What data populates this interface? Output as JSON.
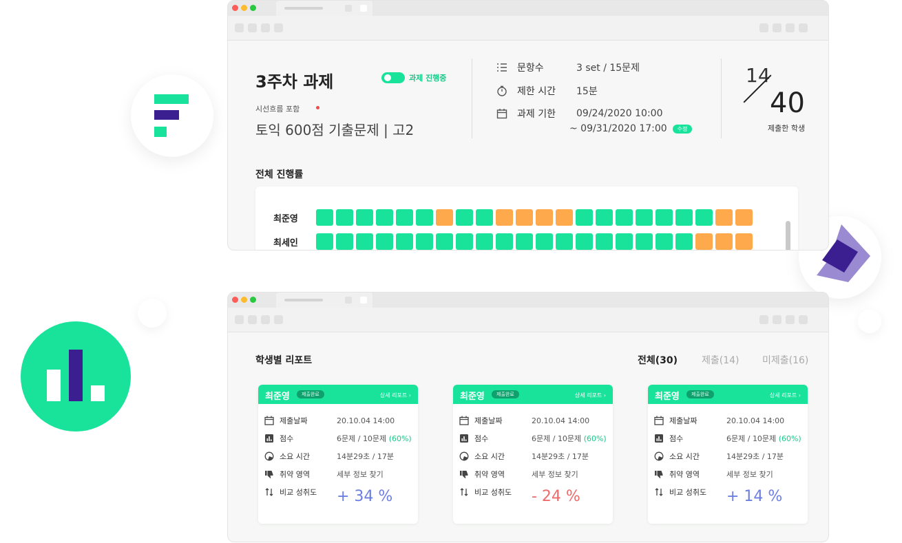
{
  "colors": {
    "accent": "#19e39a",
    "orange": "#ffa94d",
    "purple": "#3b1e8f",
    "purple_light": "#9a8ad1",
    "positive_blue": "#6c7ee1",
    "negative_red": "#f06a6a"
  },
  "assignment": {
    "title": "3주차 과제",
    "status": "과제 진행중",
    "category": "시선흐름 포함",
    "exam": "토익 600점 기출문제 |  고2",
    "info": [
      {
        "icon": "list-icon",
        "label": "문항수",
        "value": "3 set / 15문제"
      },
      {
        "icon": "timer-icon",
        "label": "제한 시간",
        "value": "15분"
      },
      {
        "icon": "calendar-icon",
        "label": "과제 기한",
        "value": "09/24/2020  10:00"
      }
    ],
    "deadline_end": "~  09/31/2020  17:00",
    "edit_label": "수정",
    "submitted": "14",
    "total": "40",
    "submitted_label": "제출한 학생"
  },
  "progress": {
    "title": "전체 진행률",
    "rows": [
      {
        "name": "최준영",
        "cells": [
          "g",
          "g",
          "g",
          "g",
          "g",
          "g",
          "o",
          "g",
          "g",
          "o",
          "o",
          "o",
          "o",
          "g",
          "g",
          "g",
          "g",
          "g",
          "g",
          "g",
          "o",
          "o"
        ]
      },
      {
        "name": "최세인",
        "cells": [
          "g",
          "g",
          "g",
          "g",
          "g",
          "g",
          "g",
          "g",
          "g",
          "g",
          "g",
          "g",
          "g",
          "g",
          "g",
          "g",
          "g",
          "g",
          "g",
          "o",
          "o",
          "o"
        ]
      }
    ]
  },
  "report": {
    "title": "학생별 리포트",
    "filters": [
      {
        "label": "전체(30)",
        "active": true
      },
      {
        "label": "제출(14)",
        "active": false
      },
      {
        "label": "미제출(16)",
        "active": false
      }
    ],
    "field_labels": {
      "date": "제출날짜",
      "score": "점수",
      "time": "소요 시간",
      "weak": "취약 영역",
      "compare": "비교 성취도"
    },
    "cards": [
      {
        "name": "최준영",
        "badge": "제출완료",
        "link": "상세 리포트 ›",
        "date": "20.10.04 14:00",
        "score": "6문제 / 10문제",
        "score_pct": "(60%)",
        "time": "14분29초 / 17분",
        "weak": "세부 정보 찾기",
        "compare": "+ 34 %",
        "compare_positive": true
      },
      {
        "name": "최준영",
        "badge": "제출완료",
        "link": "상세 리포트 ›",
        "date": "20.10.04 14:00",
        "score": "6문제 / 10문제",
        "score_pct": "(60%)",
        "time": "14분29초 / 17분",
        "weak": "세부 정보 찾기",
        "compare": "- 24 %",
        "compare_positive": false
      },
      {
        "name": "최준영",
        "badge": "제출완료",
        "link": "상세 리포트 ›",
        "date": "20.10.04 14:00",
        "score": "6문제 / 10문제",
        "score_pct": "(60%)",
        "time": "14분29초 / 17분",
        "weak": "세부 정보 찾기",
        "compare": "+ 14 %",
        "compare_positive": true
      }
    ]
  }
}
